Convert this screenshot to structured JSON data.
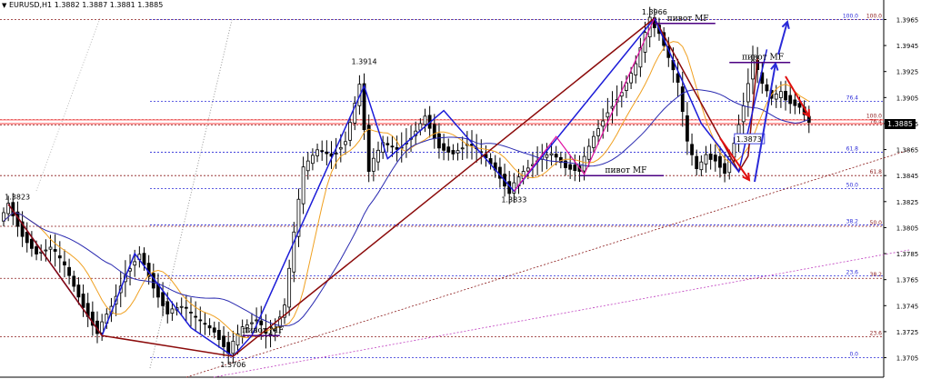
{
  "header": {
    "symbol": "EURUSD,H1",
    "ohlc": "1.3882 1.3887 1.3881 1.3885"
  },
  "current_price": "1.3885",
  "chart_data": {
    "type": "candlestick",
    "symbol": "EURUSD",
    "timeframe": "H1",
    "ylim": [
      1.369,
      1.398
    ],
    "y_ticks": [
      "1.3965",
      "1.3945",
      "1.3925",
      "1.3905",
      "1.3885",
      "1.3865",
      "1.3845",
      "1.3825",
      "1.3805",
      "1.3785",
      "1.3765",
      "1.3745",
      "1.3725",
      "1.3705"
    ],
    "price_path": [
      [
        0,
        1.381
      ],
      [
        2,
        1.3823
      ],
      [
        5,
        1.38
      ],
      [
        8,
        1.3785
      ],
      [
        11,
        1.379
      ],
      [
        14,
        1.3775
      ],
      [
        18,
        1.3745
      ],
      [
        21,
        1.3725
      ],
      [
        24,
        1.3745
      ],
      [
        27,
        1.377
      ],
      [
        30,
        1.3785
      ],
      [
        33,
        1.376
      ],
      [
        36,
        1.374
      ],
      [
        39,
        1.3745
      ],
      [
        42,
        1.3735
      ],
      [
        46,
        1.3725
      ],
      [
        49,
        1.371
      ],
      [
        52,
        1.3728
      ],
      [
        55,
        1.3735
      ],
      [
        57,
        1.3722
      ],
      [
        59,
        1.3728
      ],
      [
        61,
        1.3745
      ],
      [
        63,
        1.38
      ],
      [
        65,
        1.385
      ],
      [
        68,
        1.3865
      ],
      [
        71,
        1.386
      ],
      [
        74,
        1.3872
      ],
      [
        77,
        1.3914
      ],
      [
        79,
        1.385
      ],
      [
        82,
        1.387
      ],
      [
        85,
        1.3865
      ],
      [
        88,
        1.3875
      ],
      [
        91,
        1.389
      ],
      [
        94,
        1.3868
      ],
      [
        97,
        1.3862
      ],
      [
        100,
        1.387
      ],
      [
        103,
        1.3862
      ],
      [
        106,
        1.385
      ],
      [
        109,
        1.3833
      ],
      [
        112,
        1.3848
      ],
      [
        115,
        1.3858
      ],
      [
        118,
        1.3862
      ],
      [
        121,
        1.3852
      ],
      [
        124,
        1.385
      ],
      [
        127,
        1.3875
      ],
      [
        130,
        1.3895
      ],
      [
        133,
        1.391
      ],
      [
        136,
        1.393
      ],
      [
        139,
        1.3965
      ],
      [
        141,
        1.3955
      ],
      [
        143,
        1.3935
      ],
      [
        145,
        1.3915
      ],
      [
        147,
        1.387
      ],
      [
        149,
        1.385
      ],
      [
        151,
        1.386
      ],
      [
        153,
        1.3858
      ],
      [
        155,
        1.3848
      ],
      [
        157,
        1.387
      ],
      [
        159,
        1.39
      ],
      [
        161,
        1.3935
      ],
      [
        163,
        1.3915
      ],
      [
        165,
        1.3905
      ],
      [
        167,
        1.3908
      ],
      [
        169,
        1.3902
      ],
      [
        171,
        1.3898
      ],
      [
        173,
        1.3885
      ]
    ],
    "fractal_points": [
      {
        "label": "1.3823",
        "value": 1.3823
      },
      {
        "label": "1.3914",
        "value": 1.3914
      },
      {
        "label": "1.3833",
        "value": 1.3833
      },
      {
        "label": "1.3966",
        "value": 1.3966
      },
      {
        "label": "1.3873",
        "value": 1.3873
      },
      {
        "label": "1.3706",
        "value": 1.3706
      }
    ],
    "pivot_label": "пивот MF",
    "fib_levels_left": [
      {
        "label": "100.0",
        "value": 1.3965
      },
      {
        "label": "76.4",
        "value": 1.3902
      },
      {
        "label": "61.8",
        "value": 1.3863
      },
      {
        "label": "50.0",
        "value": 1.3835
      },
      {
        "label": "38.2",
        "value": 1.3807
      },
      {
        "label": "23.6",
        "value": 1.3768
      },
      {
        "label": "0.0",
        "value": 1.3705
      }
    ],
    "fib_levels_right": [
      {
        "label": "100.0",
        "value": 1.3965
      },
      {
        "label": "100.0",
        "value": 1.3888
      },
      {
        "label": "76.4",
        "value": 1.3884
      },
      {
        "label": "61.8",
        "value": 1.3845
      },
      {
        "label": "50.0",
        "value": 1.3806
      },
      {
        "label": "38.2",
        "value": 1.3766
      },
      {
        "label": "23.6",
        "value": 1.3721
      }
    ],
    "colors": {
      "candles": "#000000",
      "ma_fast": "#f0a020",
      "ma_slow": "#2a2ab0",
      "zigzag_blue": "#1c1cd8",
      "zigzag_brown": "#8b0a0a",
      "zigzag_magenta": "#e010a0",
      "pivot_line": "#4b0082",
      "fib_blue": "#2a2ad8",
      "fib_brown": "#8b1a1a",
      "price_line": "#ff4040",
      "arrow_red": "#e01010",
      "arrow_blue": "#2a2ad8"
    },
    "grid": false
  }
}
